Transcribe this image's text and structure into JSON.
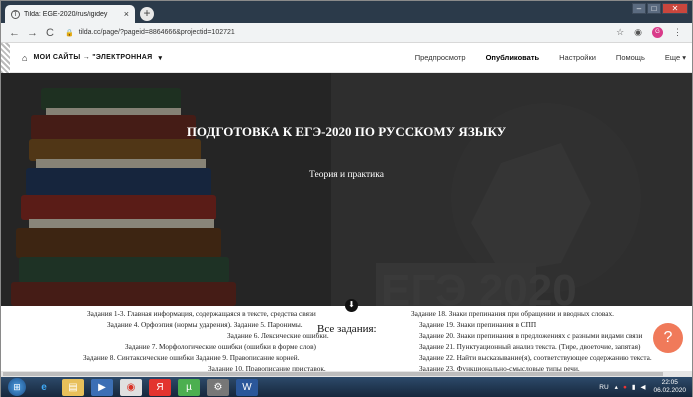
{
  "browser": {
    "tab_title": "Tilda: EGE-2020/rus/igidey",
    "tab_close": "×",
    "new_tab": "+",
    "back": "←",
    "forward": "→",
    "reload": "C",
    "url": "tilda.cc/page/?pageid=8864666&projectid=102721",
    "avatar_letter": "G"
  },
  "tilda": {
    "home_icon": "home-icon",
    "breadcrumb": "МОИ САЙТЫ → \"ЭЛЕКТРОННАЯ",
    "dropdown_arrow": "▾",
    "menu": {
      "preview": "Предпросмотр",
      "publish": "Опубликовать",
      "settings": "Настройки",
      "help": "Помощь",
      "more": "Еще ▾"
    }
  },
  "hero": {
    "title": "ПОДГОТОВКА К ЕГЭ-2020 ПО РУССКОМУ ЯЗЫКУ",
    "subtitle": "Теория и практика",
    "scroll_icon": "⬇"
  },
  "content": {
    "heading": "Все задания:",
    "left_lines": [
      "Задания 1-3. Главная информация, содержащаяся в тексте, средства связи",
      "Задание 4. Орфоэпия (нормы ударения).        Задание 5. Паронимы.",
      "Задание 6. Лексические ошибки.",
      "Задание 7. Морфологические ошибки (ошибки в форме слов)",
      "Задание 8. Синтаксические ошибки        Задание 9. Правописание корней.",
      "Задание 10. Правописание приставок."
    ],
    "right_lines": [
      "Задание 18. Знаки препинания при обращении и вводных словах.",
      "Задание 19. Знаки препинания в СПП",
      "Задание 20. Знаки препинания в предложениях с разными видами связи",
      "Задание 21. Пунктуационный анализ текста. (Тире, двоеточие, запятая)",
      "Задание 22. Найти высказывание(я), соответствующее содержанию текста.",
      "Задание 23. Функционально-смысловые типы речи."
    ]
  },
  "help_button": "?",
  "taskbar": {
    "lang": "RU",
    "time": "22:05",
    "date": "06.02.2020"
  }
}
